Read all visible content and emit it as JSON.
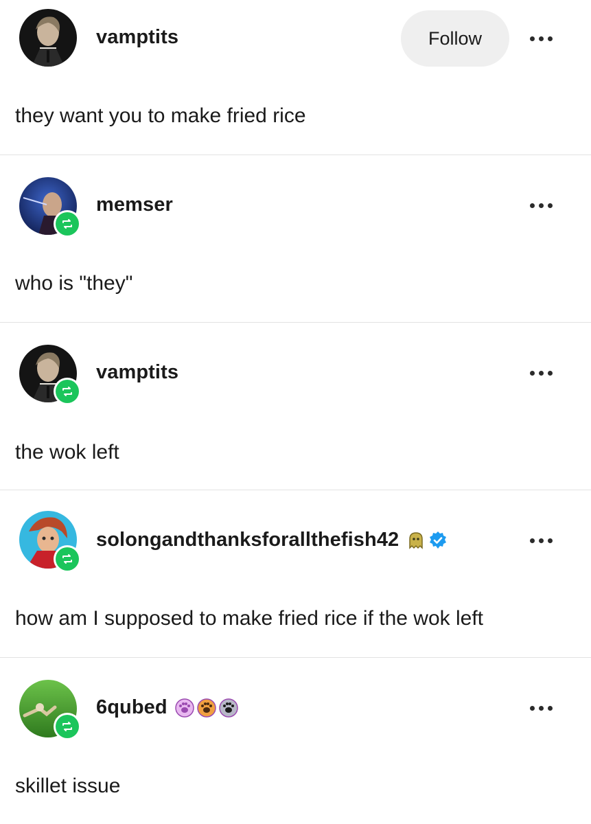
{
  "posts": [
    {
      "username": "vamptits",
      "follow_label": "Follow",
      "text": "they want you to make fried rice"
    },
    {
      "username": "memser",
      "text": "who is \"they\""
    },
    {
      "username": "vamptits",
      "text": "the wok left"
    },
    {
      "username": "solongandthanksforallthefish42",
      "badges": [
        "ghost-badge-icon",
        "verified-check-icon"
      ],
      "text": "how am I supposed to make fried rice if the wok left"
    },
    {
      "username": "6qubed",
      "badges": [
        "pink-paw-badge-icon",
        "orange-paw-badge-icon",
        "gray-paw-badge-icon"
      ],
      "text": "skillet issue"
    }
  ],
  "colors": {
    "reblog_green": "#1bc55b",
    "verified_blue": "#1d9bf0",
    "follow_button_bg": "#efefef",
    "divider": "#e2e2e2"
  },
  "icons": {
    "reblog": "reblog-icon",
    "more": "more-options-icon"
  }
}
